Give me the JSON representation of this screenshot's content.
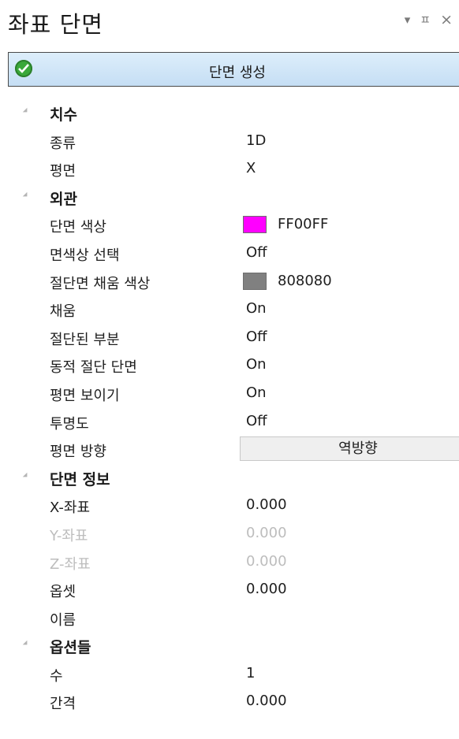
{
  "panel": {
    "title": "좌표 단면",
    "icons": [
      "dropdown-arrow-icon",
      "pin-icon",
      "close-icon"
    ],
    "icon_glyphs": {
      "dropdown": "▾",
      "pin": "ㅍ",
      "close": "×"
    }
  },
  "generate_button": {
    "label": "단면 생성",
    "icon": "check-icon"
  },
  "dimension": {
    "label": "치수",
    "type": {
      "name": "종류",
      "value": "1D"
    },
    "plane": {
      "name": "평면",
      "value": "X"
    }
  },
  "appearance": {
    "label": "외관",
    "section_color": {
      "name": "단면 색상",
      "value": "FF00FF",
      "color": "#FF00FF"
    },
    "face_color_select": {
      "name": "면색상 선택",
      "value": "Off"
    },
    "cut_fill_color": {
      "name": "절단면 채움 색상",
      "value": "808080",
      "color": "#808080"
    },
    "fill": {
      "name": "채움",
      "value": "On"
    },
    "cut_part": {
      "name": "절단된 부분",
      "value": "Off"
    },
    "dynamic_cut": {
      "name": "동적 절단 단면",
      "value": "On"
    },
    "show_plane": {
      "name": "평면 보이기",
      "value": "On"
    },
    "transparency": {
      "name": "투명도",
      "value": "Off"
    },
    "plane_direction": {
      "name": "평면 방향",
      "value": "역방향"
    }
  },
  "section_info": {
    "label": "단면 정보",
    "x": {
      "name": "X-좌표",
      "value": "0.000"
    },
    "y": {
      "name": "Y-좌표",
      "value": "0.000"
    },
    "z": {
      "name": "Z-좌표",
      "value": "0.000"
    },
    "offset": {
      "name": "옵셋",
      "value": "0.000"
    },
    "name": {
      "name": "이름",
      "value": ""
    }
  },
  "options": {
    "label": "옵션들",
    "count": {
      "name": "수",
      "value": "1"
    },
    "interval": {
      "name": "간격",
      "value": "0.000"
    }
  }
}
